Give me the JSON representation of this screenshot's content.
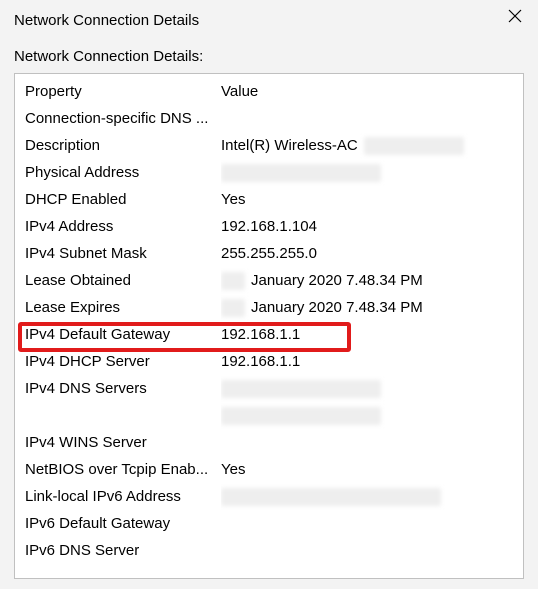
{
  "window": {
    "title": "Network Connection Details",
    "close_icon": "close"
  },
  "subtitle": "Network Connection Details:",
  "columns": {
    "property": "Property",
    "value": "Value"
  },
  "rows": [
    {
      "property": "Connection-specific DNS ...",
      "value": "",
      "redact": null
    },
    {
      "property": "Description",
      "value": "Intel(R) Wireless-AC",
      "redact": "after-w100"
    },
    {
      "property": "Physical Address",
      "value": "",
      "redact": "w160"
    },
    {
      "property": "DHCP Enabled",
      "value": "Yes",
      "redact": null
    },
    {
      "property": "IPv4 Address",
      "value": "192.168.1.104",
      "redact": null
    },
    {
      "property": "IPv4 Subnet Mask",
      "value": "255.255.255.0",
      "redact": null
    },
    {
      "property": "Lease Obtained",
      "value": "January 2020 7.48.34 PM",
      "redact": "before-w24"
    },
    {
      "property": "Lease Expires",
      "value": "January 2020 7.48.34 PM",
      "redact": "before-w24"
    },
    {
      "property": "IPv4 Default Gateway",
      "value": "192.168.1.1",
      "redact": null,
      "highlight": true
    },
    {
      "property": "IPv4 DHCP Server",
      "value": "192.168.1.1",
      "redact": null
    },
    {
      "property": "IPv4 DNS Servers",
      "value": "",
      "redact": "w160"
    },
    {
      "property": "",
      "value": "",
      "redact": "w160"
    },
    {
      "property": "IPv4 WINS Server",
      "value": "",
      "redact": null
    },
    {
      "property": "NetBIOS over Tcpip Enab...",
      "value": "Yes",
      "redact": null
    },
    {
      "property": "Link-local IPv6 Address",
      "value": "",
      "redact": "w220"
    },
    {
      "property": "IPv6 Default Gateway",
      "value": "",
      "redact": null
    },
    {
      "property": "IPv6 DNS Server",
      "value": "",
      "redact": null
    }
  ]
}
